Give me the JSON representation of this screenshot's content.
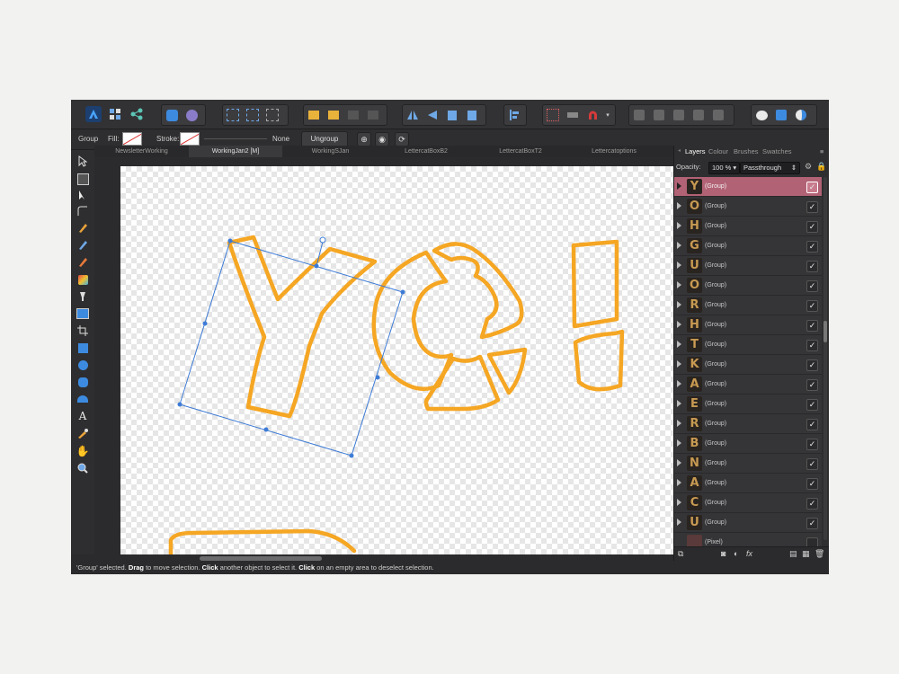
{
  "context_toolbar": {
    "selection_type": "Group",
    "fill_label": "Fill:",
    "stroke_label": "Stroke:",
    "stroke_value": "None",
    "ungroup_label": "Ungroup"
  },
  "tabs": [
    {
      "label": "NewsletterWorking",
      "active": false
    },
    {
      "label": "WorkingJan2 [M]",
      "active": true
    },
    {
      "label": "WorkingSJan",
      "active": false
    },
    {
      "label": "LettercatBoxB2",
      "active": false
    },
    {
      "label": "LettercatBoxT2",
      "active": false
    },
    {
      "label": "Lettercatoptions",
      "active": false
    }
  ],
  "panel": {
    "tabs": [
      "Layers",
      "Colour",
      "Brushes",
      "Swatches"
    ],
    "active_tab": "Layers",
    "opacity_label": "Opacity:",
    "opacity_value": "100 %",
    "blend_mode": "Passthrough"
  },
  "layers": [
    {
      "glyph": "Y",
      "name": "(Group)",
      "visible": true,
      "selected": true
    },
    {
      "glyph": "O",
      "name": "(Group)",
      "visible": true
    },
    {
      "glyph": "H",
      "name": "(Group)",
      "visible": true
    },
    {
      "glyph": "G",
      "name": "(Group)",
      "visible": true
    },
    {
      "glyph": "U",
      "name": "(Group)",
      "visible": true
    },
    {
      "glyph": "O",
      "name": "(Group)",
      "visible": true
    },
    {
      "glyph": "R",
      "name": "(Group)",
      "visible": true
    },
    {
      "glyph": "H",
      "name": "(Group)",
      "visible": true
    },
    {
      "glyph": "T",
      "name": "(Group)",
      "visible": true
    },
    {
      "glyph": "K",
      "name": "(Group)",
      "visible": true
    },
    {
      "glyph": "A",
      "name": "(Group)",
      "visible": true
    },
    {
      "glyph": "E",
      "name": "(Group)",
      "visible": true
    },
    {
      "glyph": "R",
      "name": "(Group)",
      "visible": true
    },
    {
      "glyph": "B",
      "name": "(Group)",
      "visible": true
    },
    {
      "glyph": "N",
      "name": "(Group)",
      "visible": true
    },
    {
      "glyph": "A",
      "name": "(Group)",
      "visible": true
    },
    {
      "glyph": "C",
      "name": "(Group)",
      "visible": true
    },
    {
      "glyph": "U",
      "name": "(Group)",
      "visible": true
    },
    {
      "glyph": "",
      "name": "(Pixel)",
      "visible": false
    }
  ],
  "status": {
    "p1": "'Group' selected. ",
    "b1": "Drag",
    "p2": " to move selection. ",
    "b2": "Click",
    "p3": " another object to select it. ",
    "b3": "Click",
    "p4": " on an empty area to deselect selection."
  },
  "colors": {
    "outline": "#f5a623",
    "selection": "#3d7bd6",
    "selected_layer": "#b26275"
  }
}
